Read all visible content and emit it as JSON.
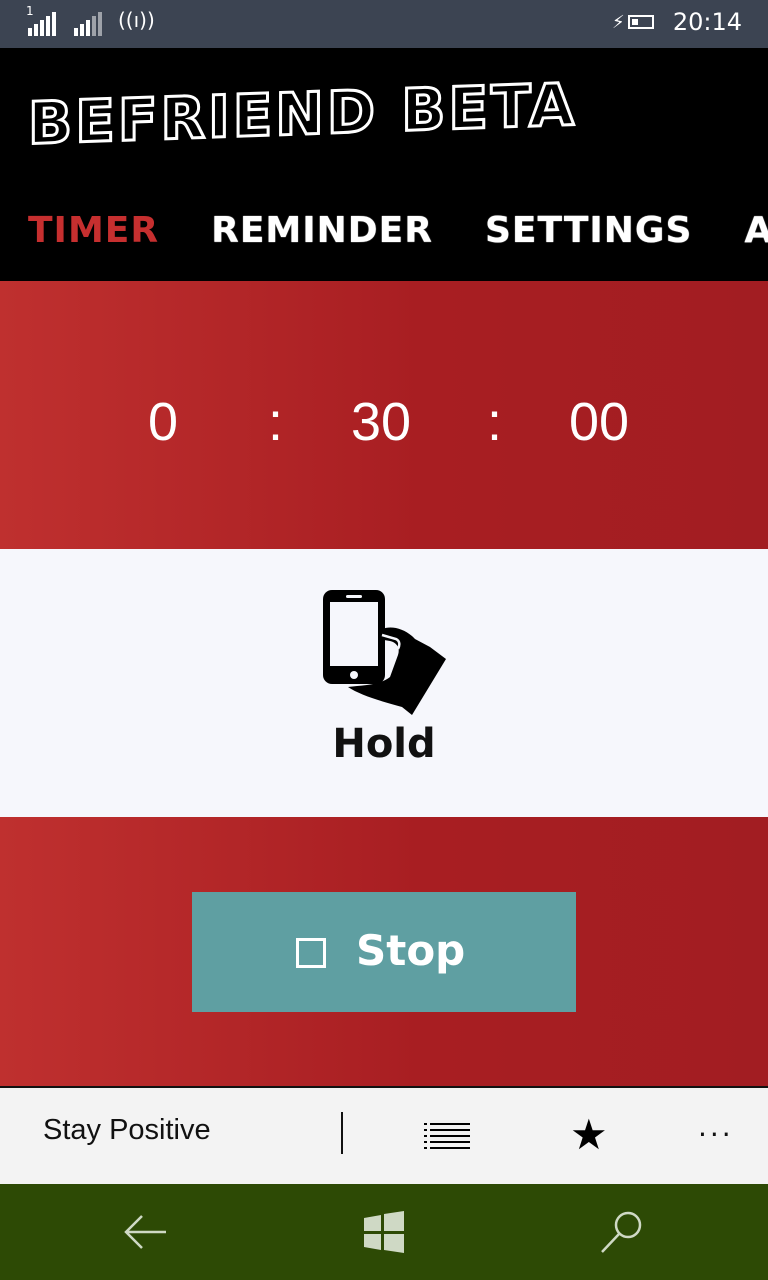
{
  "status_bar": {
    "sim1_label": "1",
    "time": "20:14",
    "icons": [
      "signal-strength-icon",
      "signal-strength-icon",
      "wifi-icon",
      "battery-charging-icon"
    ]
  },
  "header": {
    "app_title": "BEFRIEND BETA",
    "tabs": [
      {
        "label": "TIMER",
        "active": true
      },
      {
        "label": "REMINDER",
        "active": false
      },
      {
        "label": "SETTINGS",
        "active": false
      },
      {
        "label": "ABO",
        "active": false
      }
    ],
    "active_tab_color": "#c62f2f"
  },
  "timer": {
    "hours": "0",
    "minutes": "30",
    "seconds": "00",
    "separator": ":"
  },
  "hold": {
    "label": "Hold",
    "icon": "hand-holding-phone-icon"
  },
  "stop_button": {
    "label": "Stop",
    "icon": "stop-square-icon",
    "color": "#5f9fa2"
  },
  "app_bar": {
    "quote": "Stay Positive",
    "list_icon": "list-icon",
    "star_icon": "star-icon",
    "more_label": "..."
  },
  "nav_bar": {
    "icons": [
      "back-arrow-icon",
      "windows-start-icon",
      "search-icon"
    ],
    "color": "#2d4a05"
  },
  "colors": {
    "panel_red": "#a81e22",
    "hold_background": "#f6f7fc",
    "status_bar": "#3c4452"
  }
}
